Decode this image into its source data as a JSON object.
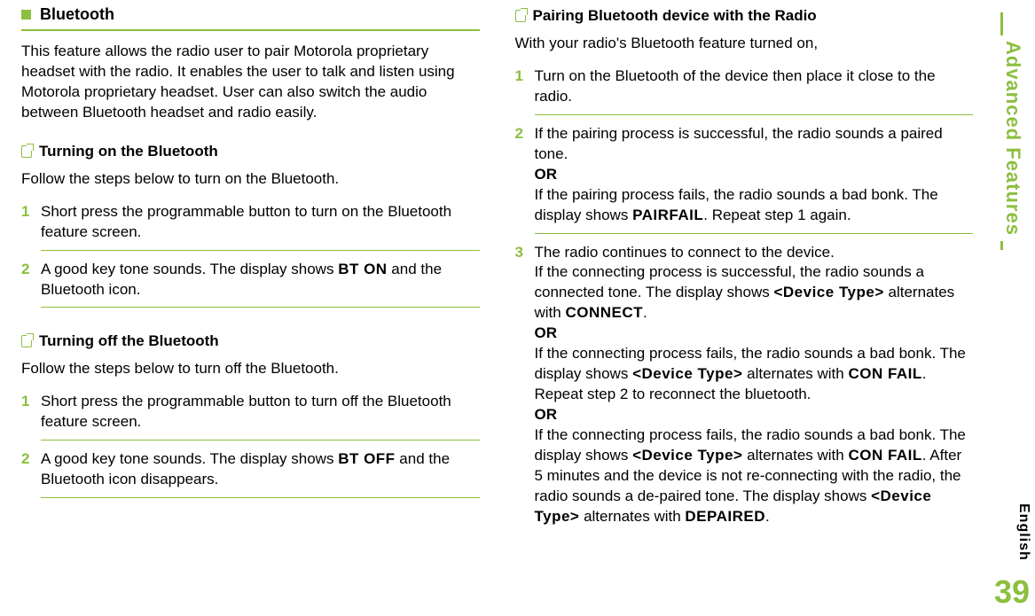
{
  "sideTab": "Advanced Features",
  "sideLang": "English",
  "pageNum": "39",
  "left": {
    "h1": "Bluetooth",
    "intro": "This feature allows the radio user to pair Motorola proprietary headset with the radio. It enables the user to talk and listen using Motorola proprietary headset. User can also switch the audio between Bluetooth headset and radio easily.",
    "sec1": {
      "title": "Turning on the Bluetooth",
      "lead": "Follow the steps below to turn on the Bluetooth.",
      "s1_num": "1",
      "s1_text": "Short press the programmable button to turn on the Bluetooth feature screen.",
      "s2_num": "2",
      "s2_pre": "A good key tone sounds. The display shows ",
      "s2_code": "BT ON",
      "s2_post": " and the Bluetooth icon."
    },
    "sec2": {
      "title": "Turning off the Bluetooth",
      "lead": "Follow the steps below to turn off the Bluetooth.",
      "s1_num": "1",
      "s1_text": "Short press the programmable button to turn off the Bluetooth feature screen.",
      "s2_num": "2",
      "s2_pre": "A good key tone sounds. The display shows ",
      "s2_code": "BT OFF",
      "s2_post": " and the Bluetooth icon disappears."
    }
  },
  "right": {
    "title": "Pairing Bluetooth device with the Radio",
    "lead": "With your radio's Bluetooth feature turned on,",
    "s1_num": "1",
    "s1_text": "Turn on the Bluetooth of the device then place it close to the radio.",
    "s2_num": "2",
    "s2_l1": "If the pairing process is successful, the radio sounds a paired tone.",
    "s2_or1": "OR",
    "s2_l2a": "If the pairing process fails, the radio sounds a bad bonk. The display shows ",
    "s2_code": "PAIRFAIL",
    "s2_l2b": ". Repeat step 1 again.",
    "s3_num": "3",
    "s3_l1": "The radio continues to connect to the device.",
    "s3_l2a": "If the connecting process is successful, the radio sounds a connected tone. The display shows ",
    "s3_dev1": "<Device Type>",
    "s3_l2b": " alternates with ",
    "s3_conn": "CONNECT",
    "s3_period": ".",
    "s3_or1": "OR",
    "s3_l3a": "If the connecting process fails, the radio sounds a bad bonk. The display shows ",
    "s3_dev2": "<Device Type>",
    "s3_l3b": " alternates with ",
    "s3_cf1": "CON FAIL",
    "s3_l3c": ". Repeat step 2 to reconnect the bluetooth.",
    "s3_or2": "OR",
    "s3_l4a": "If the connecting process fails, the radio sounds a bad bonk. The display shows ",
    "s3_dev3": "<Device Type>",
    "s3_l4b": " alternates with ",
    "s3_cf2": "CON FAIL",
    "s3_l4c": ". After 5 minutes and the device is not re-connecting with the radio, the radio sounds a de-paired tone. The display shows ",
    "s3_dev4": "<Device Type>",
    "s3_l4d": " alternates with ",
    "s3_dep": "DEPAIRED",
    "s3_l4e": "."
  }
}
